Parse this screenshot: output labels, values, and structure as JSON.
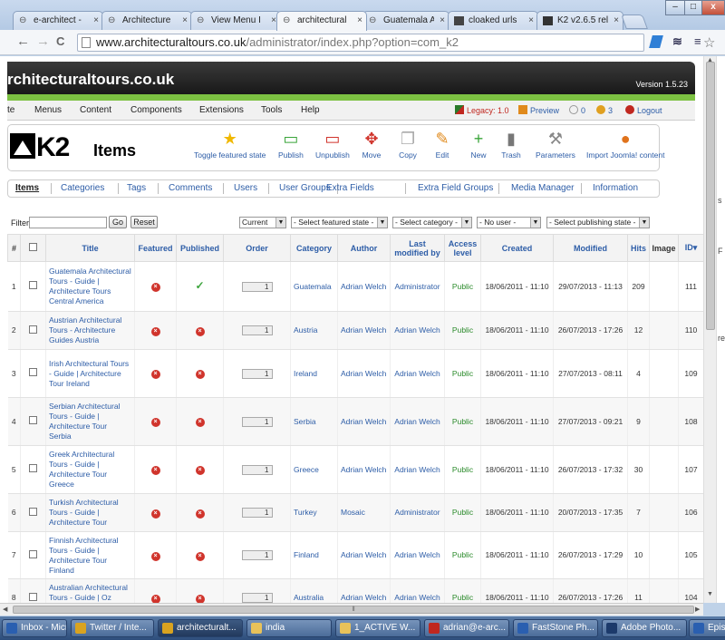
{
  "browser": {
    "tabs": [
      {
        "label": "e-architect -",
        "icon": "page-icon"
      },
      {
        "label": "Architecture",
        "icon": "page-icon"
      },
      {
        "label": "View Menu I",
        "icon": "page-icon"
      },
      {
        "label": "architectural",
        "icon": "page-icon"
      },
      {
        "label": "Guatemala A",
        "icon": "page-icon"
      },
      {
        "label": "cloaked urls",
        "icon": "image-icon"
      },
      {
        "label": "K2 v2.6.5 rele",
        "icon": "k2-icon"
      }
    ],
    "active_tab_index": 3,
    "tab_close": "×",
    "window_buttons": {
      "min": "–",
      "max": "□",
      "close": "x"
    },
    "url_host": "www.architecturaltours.co.uk",
    "url_path": "/administrator/index.php?option=com_k2",
    "nav": {
      "back": "←",
      "forward": "→",
      "reload": "C"
    }
  },
  "admin": {
    "site_name": "rchitecturaltours.co.uk",
    "version": "Version 1.5.23",
    "menu": [
      "te",
      "Menus",
      "Content",
      "Components",
      "Extensions",
      "Tools",
      "Help"
    ],
    "right": {
      "legacy": "Legacy: 1.0",
      "preview": "Preview",
      "messages": "0",
      "users": "3",
      "logout": "Logout"
    }
  },
  "k2": {
    "logo_text": "K2",
    "page_title": "Items",
    "tools": [
      {
        "label": "Toggle featured state",
        "icon": "star-icon",
        "glyph": "★",
        "color": "#f0b800"
      },
      {
        "label": "Publish",
        "icon": "publish-icon",
        "glyph": "▭",
        "color": "#3aa53a"
      },
      {
        "label": "Unpublish",
        "icon": "unpublish-icon",
        "glyph": "▭",
        "color": "#d0342c"
      },
      {
        "label": "Move",
        "icon": "move-icon",
        "glyph": "✥",
        "color": "#d0342c"
      },
      {
        "label": "Copy",
        "icon": "copy-icon",
        "glyph": "❐",
        "color": "#aaaaaa"
      },
      {
        "label": "Edit",
        "icon": "edit-icon",
        "glyph": "✎",
        "color": "#e08a1c"
      },
      {
        "label": "New",
        "icon": "new-icon",
        "glyph": "+",
        "color": "#3aa53a"
      },
      {
        "label": "Trash",
        "icon": "trash-icon",
        "glyph": "▮",
        "color": "#777777"
      },
      {
        "label": "Parameters",
        "icon": "parameters-icon",
        "glyph": "⚒",
        "color": "#888888"
      },
      {
        "label": "Import Joomla! content",
        "icon": "import-icon",
        "glyph": "●",
        "color": "#e0731c"
      }
    ],
    "subnav": [
      "Items",
      "Categories",
      "Tags",
      "Comments",
      "Users",
      "User Groups",
      "Extra Fields",
      "Extra Field Groups",
      "Media Manager",
      "Information"
    ],
    "filter": {
      "label": "Filter",
      "value": "",
      "go": "Go",
      "reset": "Reset",
      "selects": [
        "Current",
        "- Select featured state -",
        "- Select category -",
        "- No user -",
        "- Select publishing state -"
      ]
    },
    "columns": [
      "#",
      "",
      "Title",
      "Featured",
      "Published",
      "Order",
      "Category",
      "Author",
      "Last modified by",
      "Access level",
      "Created",
      "Modified",
      "Hits",
      "Image",
      "ID"
    ],
    "rows": [
      {
        "n": "1",
        "title": "Guatemala Architectural Tours - Guide | Architecture Tours Central America",
        "featured": false,
        "published": true,
        "order": "1",
        "category": "Guatemala",
        "author": "Adrian Welch",
        "modified_by": "Administrator",
        "access": "Public",
        "created": "18/06/2011 - 11:10",
        "modified": "29/07/2013 - 11:13",
        "hits": "209",
        "id": "111"
      },
      {
        "n": "2",
        "title": "Austrian Architectural Tours - Architecture Guides Austria",
        "featured": false,
        "published": false,
        "order": "1",
        "category": "Austria",
        "author": "Adrian Welch",
        "modified_by": "Adrian Welch",
        "access": "Public",
        "created": "18/06/2011 - 11:10",
        "modified": "26/07/2013 - 17:26",
        "hits": "12",
        "id": "110"
      },
      {
        "n": "3",
        "title": "Irish Architectural Tours - Guide | Architecture Tour Ireland",
        "featured": false,
        "published": false,
        "order": "1",
        "category": "Ireland",
        "author": "Adrian Welch",
        "modified_by": "Adrian Welch",
        "access": "Public",
        "created": "18/06/2011 - 11:10",
        "modified": "27/07/2013 - 08:11",
        "hits": "4",
        "id": "109"
      },
      {
        "n": "4",
        "title": "Serbian Architectural Tours - Guide | Architecture Tour Serbia",
        "featured": false,
        "published": false,
        "order": "1",
        "category": "Serbia",
        "author": "Adrian Welch",
        "modified_by": "Adrian Welch",
        "access": "Public",
        "created": "18/06/2011 - 11:10",
        "modified": "27/07/2013 - 09:21",
        "hits": "9",
        "id": "108"
      },
      {
        "n": "5",
        "title": "Greek Architectural Tours - Guide | Architecture Tour Greece",
        "featured": false,
        "published": false,
        "order": "1",
        "category": "Greece",
        "author": "Adrian Welch",
        "modified_by": "Adrian Welch",
        "access": "Public",
        "created": "18/06/2011 - 11:10",
        "modified": "26/07/2013 - 17:32",
        "hits": "30",
        "id": "107"
      },
      {
        "n": "6",
        "title": "Turkish Architectural Tours - Guide | Architecture Tour",
        "featured": false,
        "published": false,
        "order": "1",
        "category": "Turkey",
        "author": "Mosaic",
        "modified_by": "Administrator",
        "access": "Public",
        "created": "18/06/2011 - 11:10",
        "modified": "20/07/2013 - 17:35",
        "hits": "7",
        "id": "106"
      },
      {
        "n": "7",
        "title": "Finnish Architectural Tours - Guide | Architecture Tour Finland",
        "featured": false,
        "published": false,
        "order": "1",
        "category": "Finland",
        "author": "Adrian Welch",
        "modified_by": "Adrian Welch",
        "access": "Public",
        "created": "18/06/2011 - 11:10",
        "modified": "26/07/2013 - 17:29",
        "hits": "10",
        "id": "105"
      },
      {
        "n": "8",
        "title": "Australian Architectural Tours - Guide | Oz Architecture Tour",
        "featured": false,
        "published": false,
        "order": "1",
        "category": "Australia",
        "author": "Adrian Welch",
        "modified_by": "Adrian Welch",
        "access": "Public",
        "created": "18/06/2011 - 11:10",
        "modified": "26/07/2013 - 17:26",
        "hits": "11",
        "id": "104"
      }
    ],
    "featured_icon": "x-circle-icon",
    "published_icon": "checkmark-icon"
  },
  "taskbar": [
    {
      "label": "Inbox - Micr...",
      "icon": "outlook-icon",
      "color": "#2a5fb0"
    },
    {
      "label": "Twitter / Inte...",
      "icon": "chrome-icon",
      "color": "#d9a320"
    },
    {
      "label": "architecturalt...",
      "icon": "chrome-icon",
      "color": "#d9a320"
    },
    {
      "label": "india",
      "icon": "folder-icon",
      "color": "#e8c25a"
    },
    {
      "label": "1_ACTIVE W...",
      "icon": "folder-icon",
      "color": "#e8c25a"
    },
    {
      "label": "adrian@e-arc...",
      "icon": "filezilla-icon",
      "color": "#c0271f"
    },
    {
      "label": "FastStone Ph...",
      "icon": "faststone-icon",
      "color": "#2a5fb0"
    },
    {
      "label": "Adobe Photo...",
      "icon": "photoshop-icon",
      "color": "#1c3a6b"
    },
    {
      "label": "Epist",
      "icon": "app-icon",
      "color": "#2a5fb0"
    }
  ],
  "active_taskbar_index": 2,
  "right_gutter": [
    "s",
    "F",
    "re"
  ]
}
